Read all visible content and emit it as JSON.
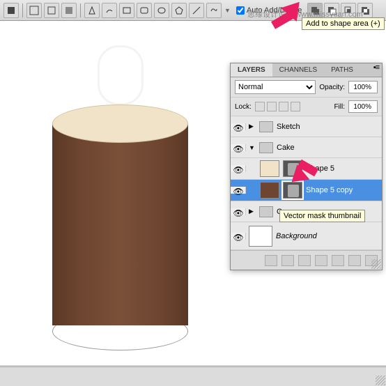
{
  "toolbar": {
    "auto_add_label": "Auto Add/Delete",
    "tooltip_add": "Add to shape area (+)"
  },
  "watermark": "思缘设计论坛 www.missyuan.com",
  "panel": {
    "tabs": {
      "layers": "LAYERS",
      "channels": "CHANNELS",
      "paths": "PATHS"
    },
    "blend_mode": "Normal",
    "opacity_label": "Opacity:",
    "opacity_value": "100%",
    "lock_label": "Lock:",
    "fill_label": "Fill:",
    "fill_value": "100%",
    "tooltip_mask": "Vector mask thumbnail",
    "layers": {
      "sketch": "Sketch",
      "cake": "Cake",
      "shape5": "Shape 5",
      "shape5copy": "Shape 5 copy",
      "group_c": "Co",
      "background": "Background"
    }
  }
}
